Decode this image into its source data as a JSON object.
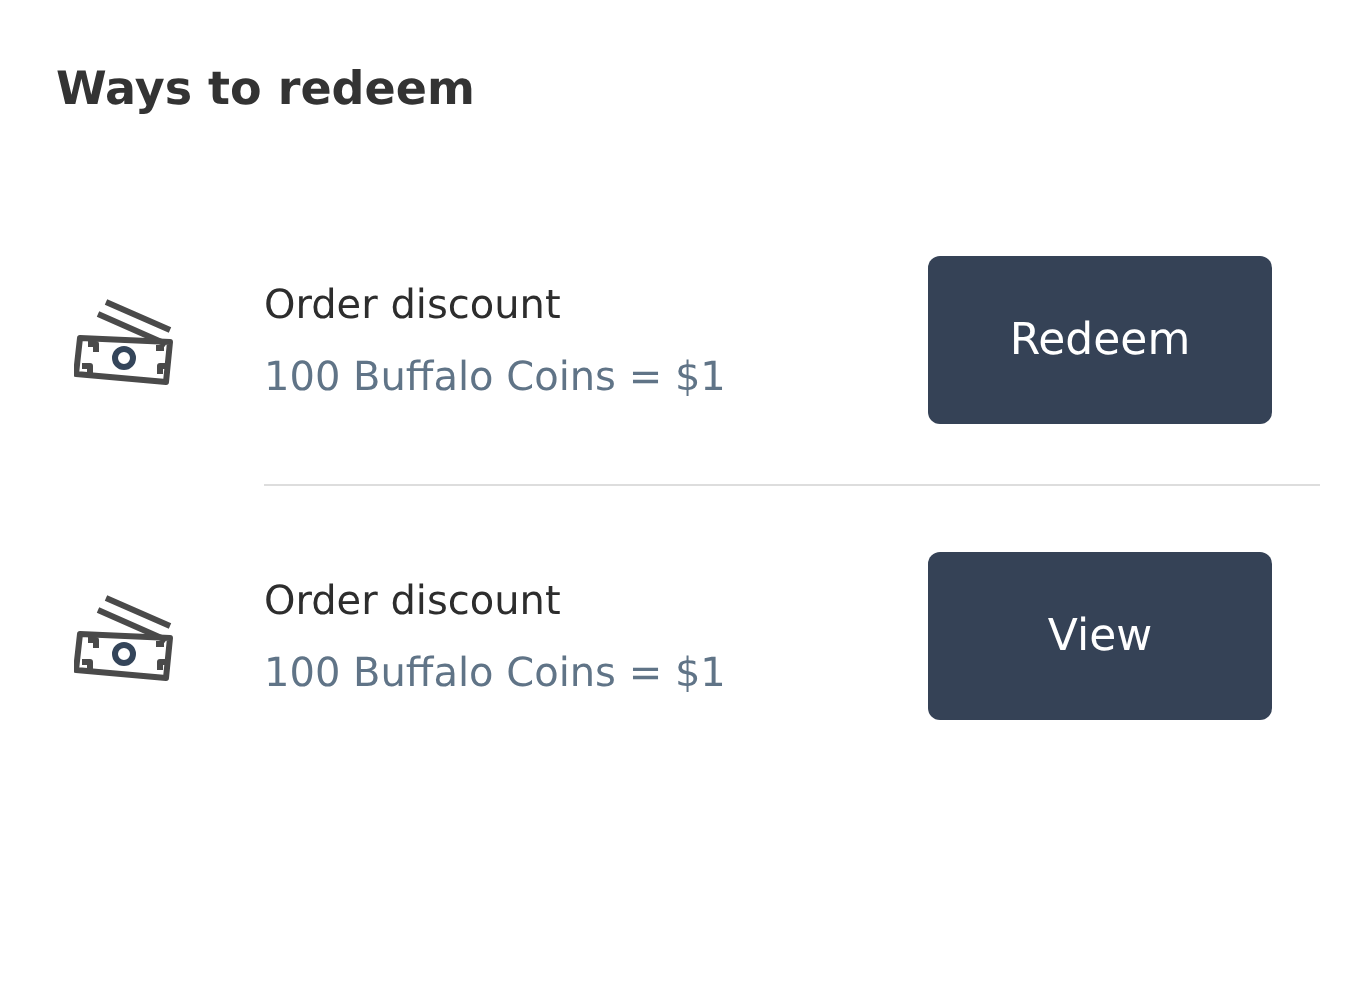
{
  "title": "Ways to redeem",
  "options": [
    {
      "name": "Order discount",
      "rate": "100 Buffalo Coins = $1",
      "button": "Redeem"
    },
    {
      "name": "Order discount",
      "rate": "100 Buffalo Coins = $1",
      "button": "View"
    }
  ]
}
